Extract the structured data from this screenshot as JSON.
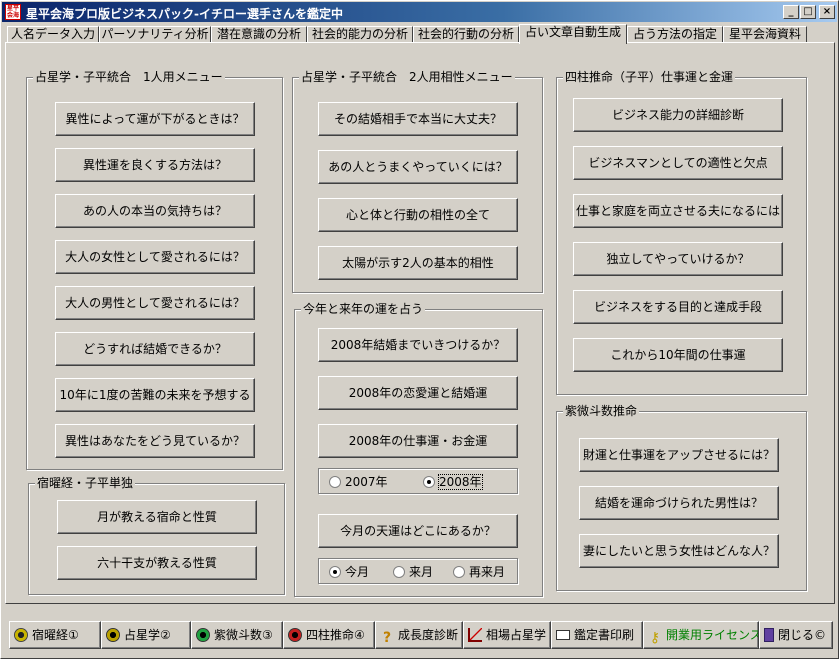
{
  "window": {
    "app_icon_text": "星平会海",
    "title": "星平会海プロ版ビジネスパック-イチロー選手さんを鑑定中",
    "controls": {
      "minimize": "_",
      "maximize": "□",
      "close": "×"
    }
  },
  "tabs": [
    {
      "label": "人名データ入力"
    },
    {
      "label": "パーソナリティ分析"
    },
    {
      "label": "潜在意識の分析"
    },
    {
      "label": "社会的能力の分析"
    },
    {
      "label": "社会的行動の分析"
    },
    {
      "label": "占い文章自動生成"
    },
    {
      "label": "占う方法の指定"
    },
    {
      "label": "星平会海資料"
    }
  ],
  "groups": {
    "astro_single": {
      "title": "占星学・子平統合　1人用メニュー",
      "buttons": [
        "異性によって運が下がるときは？",
        "異性運を良くする方法は？",
        "あの人の本当の気持ちは？",
        "大人の女性として愛されるには？",
        "大人の男性として愛されるには？",
        "どうすれば結婚できるか？",
        "10年に1度の苦難の未来を予想する",
        "異性はあなたをどう見ているか？"
      ]
    },
    "shukuyo": {
      "title": "宿曜経・子平単独",
      "buttons": [
        "月が教える宿命と性質",
        "六十干支が教える性質"
      ]
    },
    "astro_pair": {
      "title": "占星学・子平統合　2人用相性メニュー",
      "buttons": [
        "その結婚相手で本当に大丈夫？",
        "あの人とうまくやっていくには？",
        "心と体と行動の相性の全て",
        "太陽が示す2人の基本的相性"
      ]
    },
    "year_luck": {
      "title": "今年と来年の運を占う",
      "buttons": [
        "2008年結婚までいきつけるか？",
        "2008年の恋愛運と結婚運",
        "2008年の仕事運・お金運"
      ],
      "year_options": [
        "2007年",
        "2008年"
      ],
      "year_selected": "2008年",
      "month_button": "今月の天運はどこにあるか？",
      "month_options": [
        "今月",
        "来月",
        "再来月"
      ],
      "month_selected": "今月"
    },
    "shichu": {
      "title": "四柱推命（子平）仕事運と金運",
      "buttons": [
        "ビジネス能力の詳細診断",
        "ビジネスマンとしての適性と欠点",
        "仕事と家庭を両立させる夫になるには",
        "独立してやっていけるか？",
        "ビジネスをする目的と達成手段",
        "これから10年間の仕事運"
      ]
    },
    "shibi": {
      "title": "紫微斗数推命",
      "buttons": [
        "財運と仕事運をアップさせるには？",
        "結婚を運命づけられた男性は？",
        "妻にしたいと思う女性はどんな人？"
      ]
    }
  },
  "bottom_buttons": [
    {
      "label": "宿曜経①",
      "icon": "ring-yellow-icon"
    },
    {
      "label": "占星学②",
      "icon": "ring-black-icon"
    },
    {
      "label": "紫微斗数③",
      "icon": "ring-green-icon"
    },
    {
      "label": "四柱推命④",
      "icon": "ring-red-icon"
    },
    {
      "label": "成長度診断",
      "icon": "question-icon"
    },
    {
      "label": "相場占星学",
      "icon": "chart-icon"
    },
    {
      "label": "鑑定書印刷",
      "icon": "printer-icon"
    },
    {
      "label": "開業用ライセンス",
      "icon": "key-icon"
    },
    {
      "label": "閉じる©",
      "icon": "door-icon"
    }
  ]
}
